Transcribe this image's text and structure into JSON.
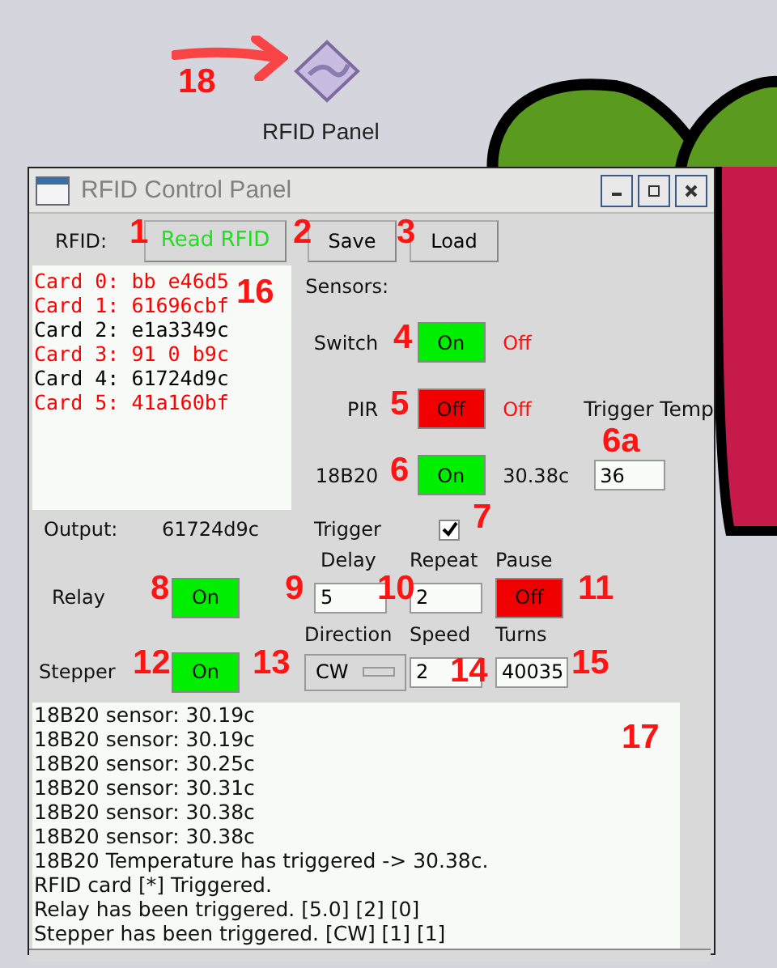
{
  "desktop": {
    "icon_label": "RFID Panel"
  },
  "window": {
    "title": "RFID Control Panel"
  },
  "rfid": {
    "label": "RFID:",
    "read_button": "Read RFID",
    "save_button": "Save",
    "load_button": "Load"
  },
  "cards": [
    {
      "text": "Card 0: bb e46d5",
      "color": "#ff0000"
    },
    {
      "text": "Card 1: 61696cbf",
      "color": "#ff0000"
    },
    {
      "text": "Card 2: e1a3349c",
      "color": "#000000"
    },
    {
      "text": "Card 3: 91 0 b9c",
      "color": "#ff0000"
    },
    {
      "text": "Card 4: 61724d9c",
      "color": "#000000"
    },
    {
      "text": "Card 5: 41a160bf",
      "color": "#ff0000"
    }
  ],
  "sensors": {
    "heading": "Sensors:",
    "rows": [
      {
        "name": "Switch",
        "on": true,
        "button": "On",
        "reading": "Off",
        "kind": "state"
      },
      {
        "name": "PIR",
        "on": false,
        "button": "Off",
        "reading": "Off",
        "kind": "state"
      },
      {
        "name": "18B20",
        "on": true,
        "button": "On",
        "reading": "30.38c",
        "kind": "temperature"
      }
    ],
    "trigger_temp": {
      "label": "Trigger Temp",
      "value": "36"
    }
  },
  "output": {
    "label": "Output:",
    "value": "61724d9c"
  },
  "trigger": {
    "label": "Trigger",
    "checked": true
  },
  "relay": {
    "label": "Relay",
    "button": "On",
    "on": true,
    "delay": {
      "label": "Delay",
      "value": "5"
    },
    "repeat": {
      "label": "Repeat",
      "value": "2"
    },
    "pause": {
      "label": "Pause",
      "button": "Off",
      "on": false
    }
  },
  "stepper": {
    "label": "Stepper",
    "button": "On",
    "on": true,
    "direction": {
      "label": "Direction",
      "value": "CW"
    },
    "speed": {
      "label": "Speed",
      "value": "2"
    },
    "turns": {
      "label": "Turns",
      "value": "40035"
    }
  },
  "log": [
    "18B20 sensor: 30.19c",
    "18B20 sensor: 30.19c",
    "18B20 sensor: 30.25c",
    "18B20 sensor: 30.31c",
    "18B20 sensor: 30.38c",
    "18B20 sensor: 30.38c",
    "18B20 Temperature has triggered -> 30.38c.",
    "RFID card [*] Triggered.",
    "Relay has been triggered. [5.0] [2] [0]",
    "Stepper has been triggered. [CW] [1] [1]"
  ],
  "annotations": [
    "18",
    "1",
    "2",
    "3",
    "16",
    "4",
    "5",
    "6a",
    "6",
    "7",
    "8",
    "9",
    "10",
    "11",
    "12",
    "13",
    "14",
    "15",
    "17"
  ]
}
